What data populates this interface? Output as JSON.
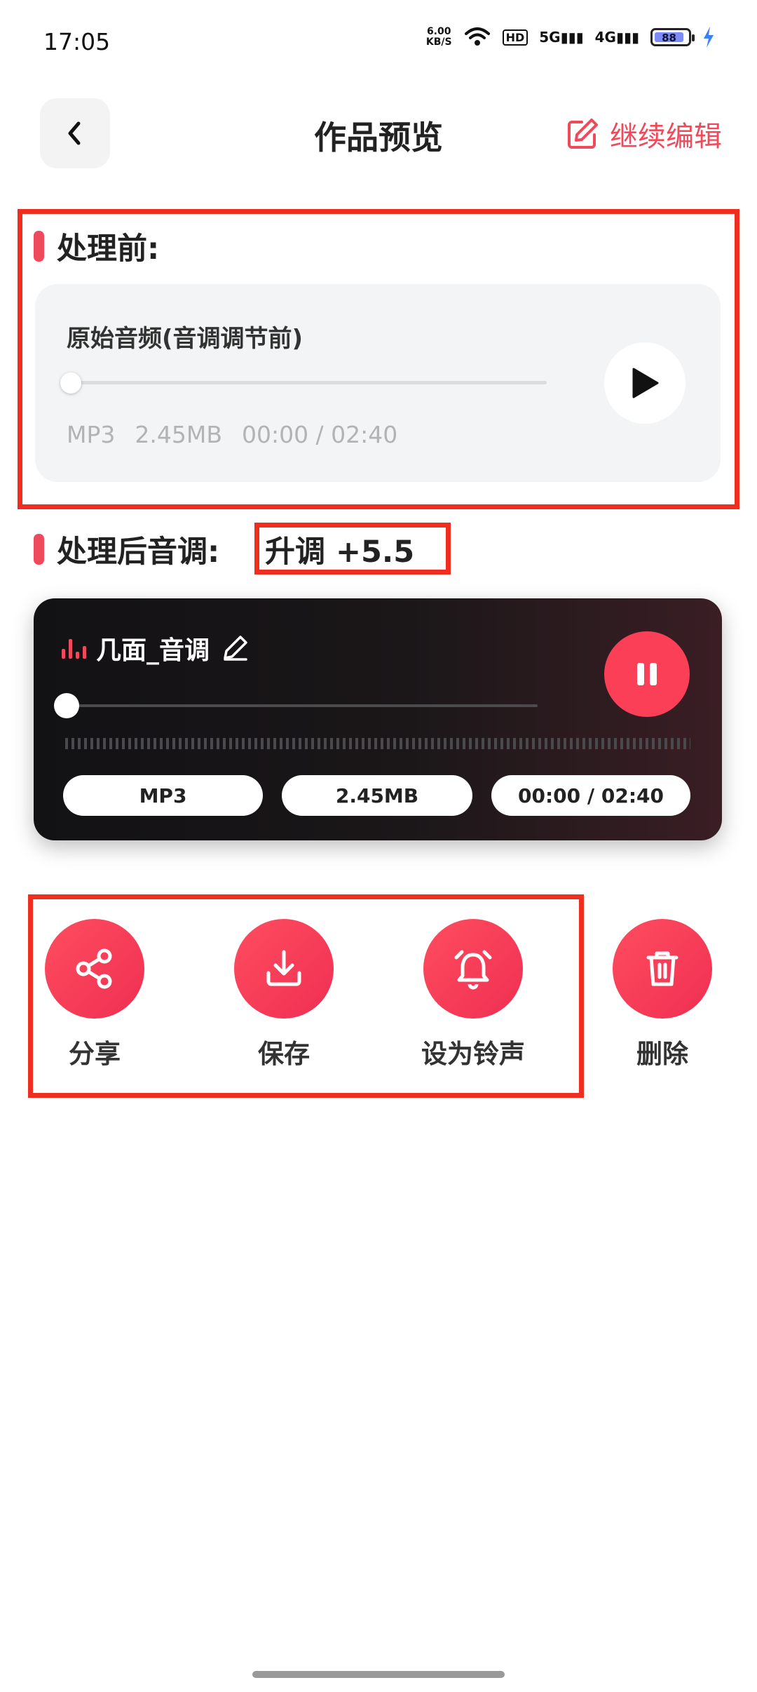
{
  "status": {
    "time": "17:05",
    "speed_value": "6.00",
    "speed_unit": "KB/S",
    "hd": "HD",
    "sig1": "5G",
    "sig2": "4G",
    "battery": "88"
  },
  "header": {
    "title": "作品预览",
    "continue_label": "继续编辑"
  },
  "before": {
    "label": "处理前:",
    "title": "原始音频(音调调节前)",
    "format": "MP3",
    "size": "2.45MB",
    "time": "00:00 / 02:40",
    "progress": 0
  },
  "after": {
    "label": "处理后音调:",
    "pitch": "升调 +5.5",
    "name": "几面_音调",
    "format": "MP3",
    "size": "2.45MB",
    "time": "00:00 / 02:40",
    "progress": 0
  },
  "actions": [
    {
      "label": "分享",
      "icon": "share-icon"
    },
    {
      "label": "保存",
      "icon": "download-icon"
    },
    {
      "label": "设为铃声",
      "icon": "alarm-bell-icon"
    },
    {
      "label": "删除",
      "icon": "trash-icon"
    }
  ],
  "colors": {
    "accent": "#ef4a5b",
    "button": "#fb3f57",
    "annotation": "#ee2e1e"
  }
}
